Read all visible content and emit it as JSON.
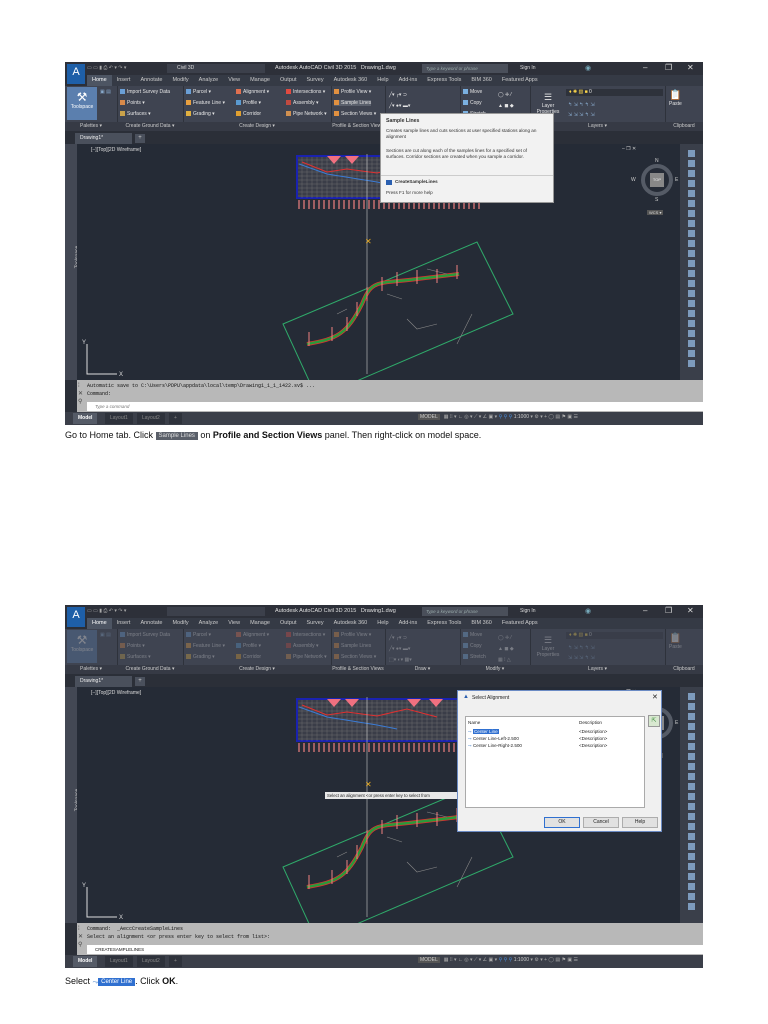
{
  "screens": [
    {
      "title": "Autodesk AutoCAD Civil 3D 2015   Drawing1.dwg",
      "workspace": "Civil 3D",
      "search_placeholder": "Type a keyword or phrase",
      "sign_in": "Sign In",
      "logo": "C3D",
      "tabs": [
        "Home",
        "Insert",
        "Annotate",
        "Modify",
        "Analyze",
        "View",
        "Manage",
        "Output",
        "Survey",
        "Autodesk 360",
        "Help",
        "Add-ins",
        "Express Tools",
        "BIM 360",
        "Featured Apps"
      ],
      "panels": {
        "palettes": {
          "label": "Palettes ▾",
          "big": "Toolspace"
        },
        "ground": {
          "label": "Create Ground Data ▾",
          "items": [
            "Import Survey Data",
            "Points ▾",
            "Surfaces ▾"
          ]
        },
        "design": {
          "label": "Create Design ▾",
          "items": [
            "Parcel ▾",
            "Feature Line ▾",
            "Grading ▾",
            "Alignment ▾",
            "Profile ▾",
            "Corridor",
            "Intersections ▾",
            "Assembly ▾",
            "Pipe Network ▾"
          ]
        },
        "profile": {
          "label": "Profile & Section Views",
          "items": [
            "Profile View ▾",
            "Sample Lines",
            "Section Views ▾"
          ]
        },
        "draw": {
          "label": "Draw ▾"
        },
        "modify": {
          "label": "Modify ▾",
          "items": [
            "Move",
            "Copy",
            "Stretch"
          ]
        },
        "layers": {
          "label": "Layers ▾",
          "big": "Layer Properties",
          "layer_value": "0"
        },
        "clipboard": {
          "label": "Clipboard",
          "big": "Paste"
        }
      },
      "doc_tab": "Drawing1*",
      "viewport_label": "[−][Top][2D Wireframe]",
      "toolspace_label": "Toolspace",
      "compass": {
        "n": "N",
        "s": "S",
        "e": "E",
        "w": "W",
        "top": "TOP",
        "wcs": "WCS ▾"
      },
      "command_lines": [
        "Automatic save to C:\\Users\\PDPU\\appdata\\local\\temp\\Drawing1_1_1_1422.sv$ ...",
        "Command:"
      ],
      "command_placeholder": "Type a command",
      "layout_tabs": [
        "Model",
        "Layout1",
        "Layout2"
      ],
      "status": {
        "model": "MODEL",
        "scale": "1:1000"
      },
      "tooltip": {
        "title": "Sample Lines",
        "desc": "Creates sample lines and cuts sections at user specified stations along an alignment",
        "desc2": "Sections are cut along each of the samples lines for a specified set of surfaces. Corridor sections are created when you sample a corridor.",
        "command": "CreateSampleLines",
        "help": "Press F1 for more help"
      }
    },
    {
      "title": "Autodesk AutoCAD Civil 3D 2015   Drawing1.dwg",
      "workspace": "",
      "search_placeholder": "Type a keyword or phrase",
      "sign_in": "Sign In",
      "logo": "C3D",
      "tabs": [
        "Home",
        "Insert",
        "Annotate",
        "Modify",
        "Analyze",
        "View",
        "Manage",
        "Output",
        "Survey",
        "Autodesk 360",
        "Help",
        "Add-ins",
        "Express Tools",
        "BIM 360",
        "Featured Apps"
      ],
      "panels": {
        "palettes": {
          "label": "Palettes ▾",
          "big": "Toolspace"
        },
        "ground": {
          "label": "Create Ground Data ▾",
          "items": [
            "Import Survey Data",
            "Points ▾",
            "Surfaces ▾"
          ]
        },
        "design": {
          "label": "Create Design ▾",
          "items": [
            "Parcel ▾",
            "Feature Line ▾",
            "Grading ▾",
            "Alignment ▾",
            "Profile ▾",
            "Corridor",
            "Intersections ▾",
            "Assembly ▾",
            "Pipe Network ▾"
          ]
        },
        "profile": {
          "label": "Profile & Section Views",
          "items": [
            "Profile View ▾",
            "Sample Lines",
            "Section Views ▾"
          ]
        },
        "draw": {
          "label": "Draw ▾"
        },
        "modify": {
          "label": "Modify ▾",
          "items": [
            "Move",
            "Copy",
            "Stretch"
          ]
        },
        "layers": {
          "label": "Layers ▾",
          "big": "Layer Properties",
          "layer_value": "0"
        },
        "clipboard": {
          "label": "Clipboard",
          "big": "Paste"
        }
      },
      "doc_tab": "Drawing1*",
      "viewport_label": "[−][Top][2D Wireframe]",
      "toolspace_label": "Toolspace",
      "compass": {
        "n": "N",
        "s": "S",
        "e": "E",
        "w": "W",
        "top": "TOP",
        "wcs": "WCS ▾"
      },
      "command_lines": [
        "Command:  _AeccCreateSampleLines",
        "Select an alignment <or press enter key to select from list>:"
      ],
      "command_input": "CREATESAMPLELINES",
      "layout_tabs": [
        "Model",
        "Layout1",
        "Layout2"
      ],
      "status": {
        "model": "MODEL",
        "scale": "1:1000"
      },
      "prompt": "Select an alignment <or press enter key to select from",
      "dialog": {
        "title": "Select Alignment",
        "columns": [
          "Name",
          "Description"
        ],
        "rows": [
          {
            "name": "Center Line",
            "description": "<Description>",
            "selected": true
          },
          {
            "name": "Center Line-Left-2.500",
            "description": "<Description>"
          },
          {
            "name": "Center Line-Right-2.500",
            "description": "<Description>"
          }
        ],
        "buttons": [
          "OK",
          "Cancel",
          "Help"
        ]
      }
    }
  ],
  "captions": [
    {
      "pre": "Go to Home tab. Click ",
      "button": "Sample Lines",
      "mid": " on ",
      "bold": "Profile and Section Views",
      "post": " panel. Then right-click on model space."
    },
    {
      "pre": "Select ",
      "button": "Center Line",
      "mid": ". Click ",
      "bold": "OK",
      "post": "."
    }
  ]
}
